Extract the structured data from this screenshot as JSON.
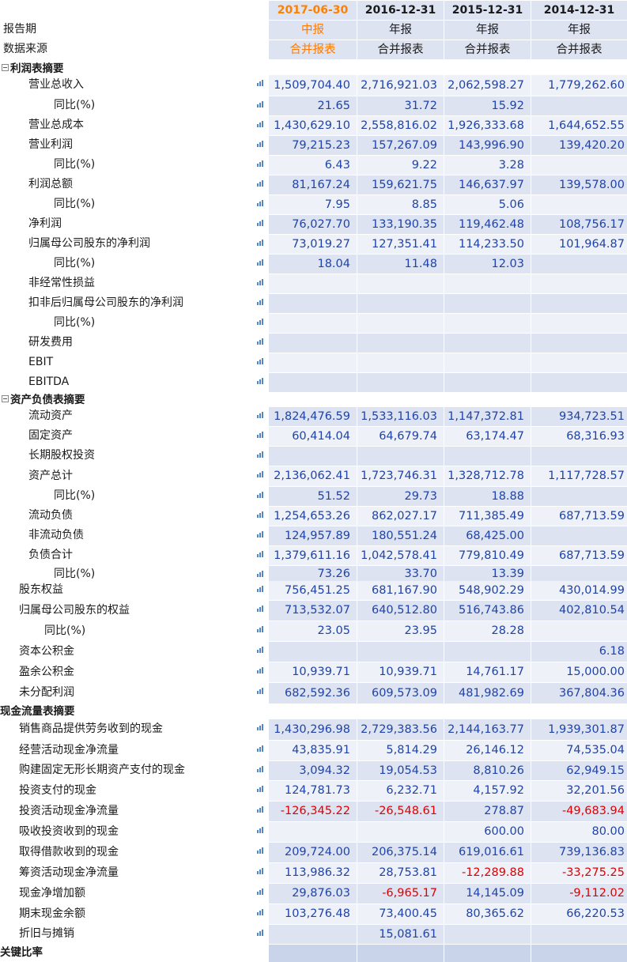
{
  "header": {
    "dates": [
      "2017-06-30",
      "2016-12-31",
      "2015-12-31",
      "2014-12-31"
    ],
    "report_period_label": "报告期",
    "report_periods": [
      "中报",
      "年报",
      "年报",
      "年报"
    ],
    "source_label": "数据来源",
    "sources": [
      "合并报表",
      "合并报表",
      "合并报表",
      "合并报表"
    ]
  },
  "sections": {
    "income": "利润表摘要",
    "balance": "资产负债表摘要",
    "cashflow": "现金流量表摘要",
    "ratios": "关键比率"
  },
  "rows": [
    {
      "label": "营业总收入",
      "values": [
        "1,509,704.40",
        "2,716,921.03",
        "2,062,598.27",
        "1,779,262.60"
      ]
    },
    {
      "label": "同比(%)",
      "values": [
        "21.65",
        "31.72",
        "15.92",
        ""
      ]
    },
    {
      "label": "营业总成本",
      "values": [
        "1,430,629.10",
        "2,558,816.02",
        "1,926,333.68",
        "1,644,652.55"
      ]
    },
    {
      "label": "营业利润",
      "values": [
        "79,215.23",
        "157,267.09",
        "143,996.90",
        "139,420.20"
      ]
    },
    {
      "label": "同比(%)",
      "values": [
        "6.43",
        "9.22",
        "3.28",
        ""
      ]
    },
    {
      "label": "利润总额",
      "values": [
        "81,167.24",
        "159,621.75",
        "146,637.97",
        "139,578.00"
      ]
    },
    {
      "label": "同比(%)",
      "values": [
        "7.95",
        "8.85",
        "5.06",
        ""
      ]
    },
    {
      "label": "净利润",
      "values": [
        "76,027.70",
        "133,190.35",
        "119,462.48",
        "108,756.17"
      ]
    },
    {
      "label": "归属母公司股东的净利润",
      "values": [
        "73,019.27",
        "127,351.41",
        "114,233.50",
        "101,964.87"
      ]
    },
    {
      "label": "同比(%)",
      "values": [
        "18.04",
        "11.48",
        "12.03",
        ""
      ]
    },
    {
      "label": "非经常性损益",
      "values": [
        "",
        "",
        "",
        ""
      ]
    },
    {
      "label": "扣非后归属母公司股东的净利润",
      "values": [
        "",
        "",
        "",
        ""
      ]
    },
    {
      "label": "同比(%)",
      "values": [
        "",
        "",
        "",
        ""
      ]
    },
    {
      "label": "研发费用",
      "values": [
        "",
        "",
        "",
        ""
      ]
    },
    {
      "label": "EBIT",
      "values": [
        "",
        "",
        "",
        ""
      ]
    },
    {
      "label": "EBITDA",
      "values": [
        "",
        "",
        "",
        ""
      ]
    },
    {
      "label": "流动资产",
      "values": [
        "1,824,476.59",
        "1,533,116.03",
        "1,147,372.81",
        "934,723.51"
      ]
    },
    {
      "label": "固定资产",
      "values": [
        "60,414.04",
        "64,679.74",
        "63,174.47",
        "68,316.93"
      ]
    },
    {
      "label": "长期股权投资",
      "values": [
        "",
        "",
        "",
        ""
      ]
    },
    {
      "label": "资产总计",
      "values": [
        "2,136,062.41",
        "1,723,746.31",
        "1,328,712.78",
        "1,117,728.57"
      ]
    },
    {
      "label": "同比(%)",
      "values": [
        "51.52",
        "29.73",
        "18.88",
        ""
      ]
    },
    {
      "label": "流动负债",
      "values": [
        "1,254,653.26",
        "862,027.17",
        "711,385.49",
        "687,713.59"
      ]
    },
    {
      "label": "非流动负债",
      "values": [
        "124,957.89",
        "180,551.24",
        "68,425.00",
        ""
      ]
    },
    {
      "label": "负债合计",
      "values": [
        "1,379,611.16",
        "1,042,578.41",
        "779,810.49",
        "687,713.59"
      ]
    },
    {
      "label": "同比(%)",
      "values": [
        "73.26",
        "33.70",
        "13.39",
        ""
      ]
    },
    {
      "label": "股东权益",
      "values": [
        "756,451.25",
        "681,167.90",
        "548,902.29",
        "430,014.99"
      ]
    },
    {
      "label": "归属母公司股东的权益",
      "values": [
        "713,532.07",
        "640,512.80",
        "516,743.86",
        "402,810.54"
      ]
    },
    {
      "label": "同比(%)",
      "values": [
        "23.05",
        "23.95",
        "28.28",
        ""
      ]
    },
    {
      "label": "资本公积金",
      "values": [
        "",
        "",
        "",
        "6.18"
      ]
    },
    {
      "label": "盈余公积金",
      "values": [
        "10,939.71",
        "10,939.71",
        "14,761.17",
        "15,000.00"
      ]
    },
    {
      "label": "未分配利润",
      "values": [
        "682,592.36",
        "609,573.09",
        "481,982.69",
        "367,804.36"
      ]
    },
    {
      "label": "销售商品提供劳务收到的现金",
      "values": [
        "1,430,296.98",
        "2,729,383.56",
        "2,144,163.77",
        "1,939,301.87"
      ]
    },
    {
      "label": "经营活动现金净流量",
      "values": [
        "43,835.91",
        "5,814.29",
        "26,146.12",
        "74,535.04"
      ]
    },
    {
      "label": "购建固定无形长期资产支付的现金",
      "values": [
        "3,094.32",
        "19,054.53",
        "8,810.26",
        "62,949.15"
      ]
    },
    {
      "label": "投资支付的现金",
      "values": [
        "124,781.73",
        "6,232.71",
        "4,157.92",
        "32,201.56"
      ]
    },
    {
      "label": "投资活动现金净流量",
      "values": [
        "-126,345.22",
        "-26,548.61",
        "278.87",
        "-49,683.94"
      ]
    },
    {
      "label": "吸收投资收到的现金",
      "values": [
        "",
        "",
        "600.00",
        "80.00"
      ]
    },
    {
      "label": "取得借款收到的现金",
      "values": [
        "209,724.00",
        "206,375.14",
        "619,016.61",
        "739,136.83"
      ]
    },
    {
      "label": "筹资活动现金净流量",
      "values": [
        "113,986.32",
        "28,753.81",
        "-12,289.88",
        "-33,275.25"
      ]
    },
    {
      "label": "现金净增加额",
      "values": [
        "29,876.03",
        "-6,965.17",
        "14,145.09",
        "-9,112.02"
      ]
    },
    {
      "label": "期末现金余额",
      "values": [
        "103,276.48",
        "73,400.45",
        "80,365.62",
        "66,220.53"
      ]
    },
    {
      "label": "折旧与摊销",
      "values": [
        "",
        "15,081.61",
        "",
        ""
      ]
    }
  ],
  "icon_name": "bar-chart-icon",
  "colors": {
    "accent": "#ff8000",
    "value": "#1f43a8",
    "negative": "#e00000",
    "row_a": "#dde3f1",
    "row_b": "#eef1f8"
  }
}
